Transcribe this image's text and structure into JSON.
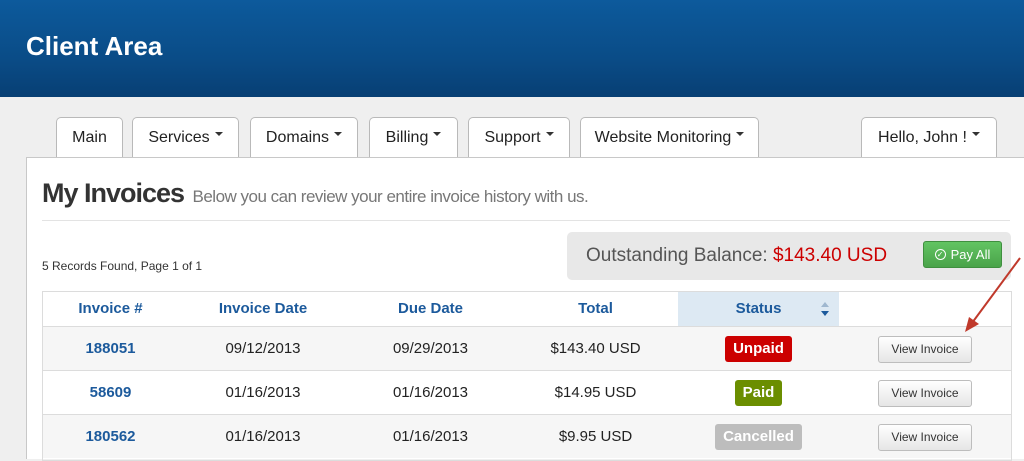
{
  "header": {
    "title": "Client Area"
  },
  "nav": {
    "tabs": [
      {
        "label": "Main",
        "dropdown": false
      },
      {
        "label": "Services",
        "dropdown": true
      },
      {
        "label": "Domains",
        "dropdown": true
      },
      {
        "label": "Billing",
        "dropdown": true
      },
      {
        "label": "Support",
        "dropdown": true
      },
      {
        "label": "Website Monitoring",
        "dropdown": true
      }
    ],
    "user_menu": {
      "label": "Hello, John !",
      "dropdown": true
    }
  },
  "page": {
    "title": "My Invoices",
    "subtitle": "Below you can review your entire invoice history with us.",
    "records_text": "5 Records Found, Page 1 of 1"
  },
  "balance": {
    "label": "Outstanding Balance:",
    "amount": "$143.40 USD",
    "pay_all_label": "Pay All",
    "amount_color": "#cc0000"
  },
  "table": {
    "columns": [
      "Invoice #",
      "Invoice Date",
      "Due Date",
      "Total",
      "Status"
    ],
    "sorted_column": "Status",
    "rows": [
      {
        "invoice": "188051",
        "invoice_date": "09/12/2013",
        "due_date": "09/29/2013",
        "total": "$143.40 USD",
        "status": "Unpaid",
        "status_color": "#cc0000",
        "action": "View Invoice"
      },
      {
        "invoice": "58609",
        "invoice_date": "01/16/2013",
        "due_date": "01/16/2013",
        "total": "$14.95 USD",
        "status": "Paid",
        "status_color": "#6b8e00",
        "action": "View Invoice"
      },
      {
        "invoice": "180562",
        "invoice_date": "01/16/2013",
        "due_date": "01/16/2013",
        "total": "$9.95 USD",
        "status": "Cancelled",
        "status_color": "#bdbdbd",
        "action": "View Invoice"
      }
    ]
  },
  "colors": {
    "header_bg": "#0a4c87",
    "link_blue": "#1c5a9c",
    "pay_green": "#4aa34a",
    "annotation_arrow": "#c0392b"
  }
}
